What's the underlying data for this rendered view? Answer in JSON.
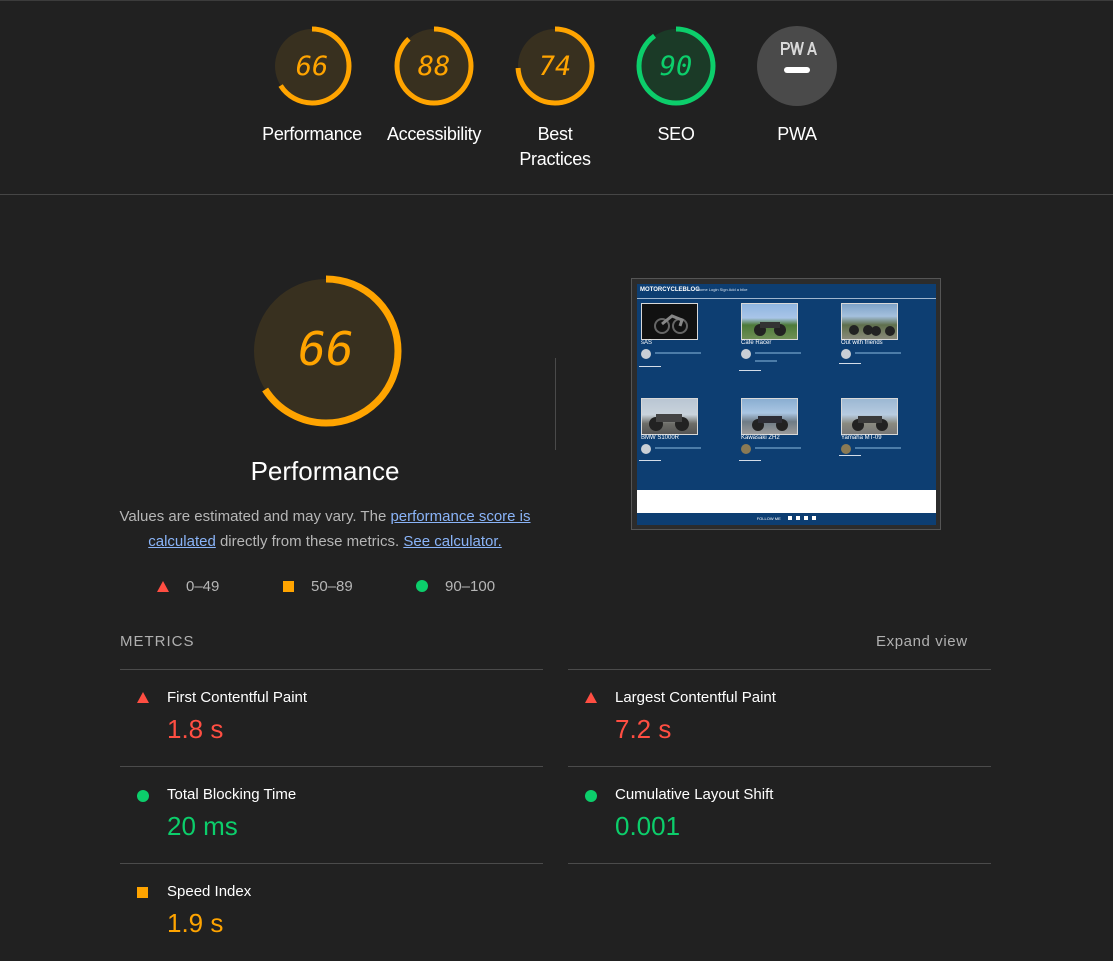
{
  "colors": {
    "fail": "#ff4e42",
    "average": "#ffa400",
    "pass": "#0cce6b",
    "na": "#ffffff"
  },
  "categories": [
    {
      "id": "performance",
      "score": "66",
      "label": "Performance",
      "status": "average",
      "fraction": 0.66
    },
    {
      "id": "accessibility",
      "score": "88",
      "label": "Accessibility",
      "status": "average",
      "fraction": 0.88
    },
    {
      "id": "best-practices",
      "score": "74",
      "label": "Best Practices",
      "status": "average",
      "fraction": 0.74
    },
    {
      "id": "seo",
      "score": "90",
      "label": "SEO",
      "status": "pass",
      "fraction": 0.9
    },
    {
      "id": "pwa",
      "score": "",
      "label": "PWA",
      "status": "na",
      "icon": "pwa-icon"
    }
  ],
  "main": {
    "score": "66",
    "fraction": 0.66,
    "title": "Performance",
    "desc_prefix": "Values are estimated and may vary. The ",
    "link_score": "performance score is calculated",
    "desc_middle": " directly from these metrics. ",
    "link_calc": "See calculator."
  },
  "legend": [
    {
      "range": "0–49",
      "icon": "triangle-icon"
    },
    {
      "range": "50–89",
      "icon": "square-icon"
    },
    {
      "range": "90–100",
      "icon": "circle-icon"
    }
  ],
  "screenshot": {
    "brand": "MOTORCYCLEBLOG",
    "nav_links": "Home   Login   Sign   Add a bike",
    "posts": [
      "sAS",
      "Cafe Racer",
      "Out with friends",
      "BMW S1000R",
      "Kawasaki ZH2",
      "Yamaha MT-09"
    ],
    "footer": "FOLLOW ME"
  },
  "metrics": {
    "header": "METRICS",
    "expand": "Expand view",
    "items": [
      {
        "name": "First Contentful Paint",
        "value": "1.8 s",
        "status": "fail"
      },
      {
        "name": "Largest Contentful Paint",
        "value": "7.2 s",
        "status": "fail"
      },
      {
        "name": "Total Blocking Time",
        "value": "20 ms",
        "status": "pass"
      },
      {
        "name": "Cumulative Layout Shift",
        "value": "0.001",
        "status": "pass"
      },
      {
        "name": "Speed Index",
        "value": "1.9 s",
        "status": "average"
      }
    ]
  }
}
